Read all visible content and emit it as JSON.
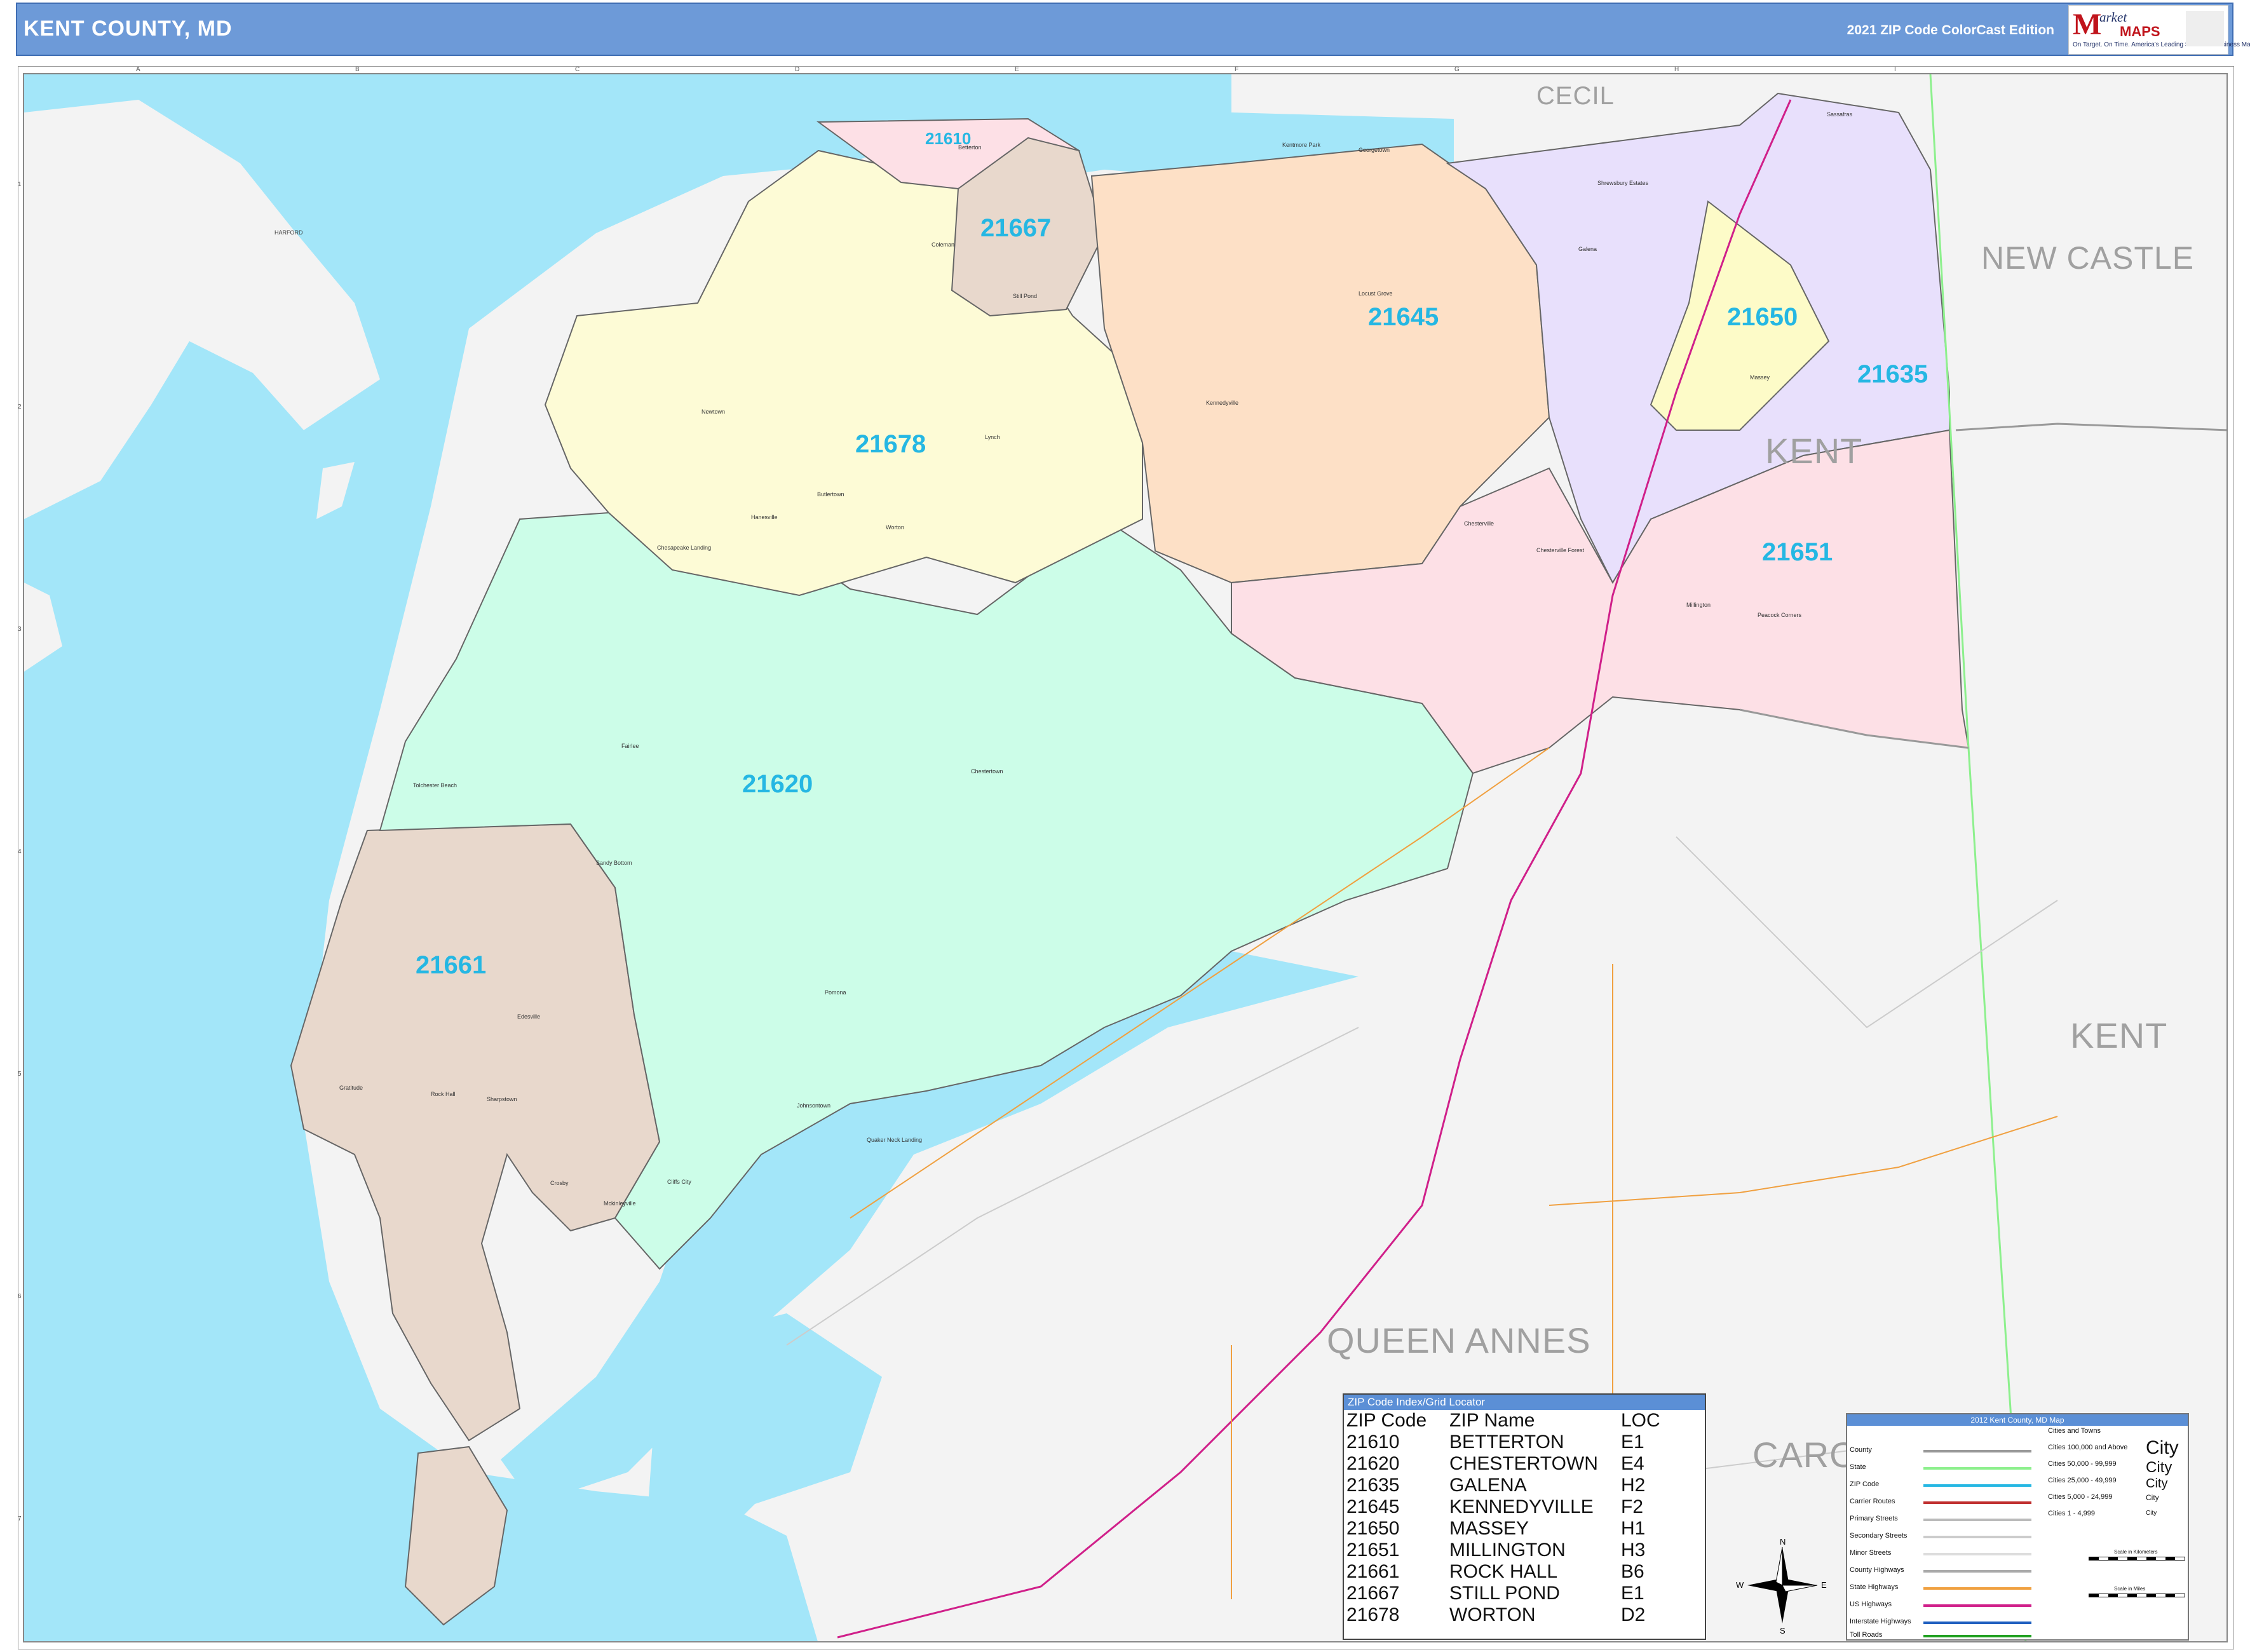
{
  "header": {
    "title": "KENT COUNTY, MD",
    "edition": "2021 ZIP Code ColorCast Edition",
    "logo": {
      "mark": "M",
      "market": "arket",
      "maps": "MAPS",
      "tagline": "On Target. On Time. America's Leading Source of Business Maps"
    }
  },
  "grid": {
    "columns": [
      "A",
      "B",
      "C",
      "D",
      "E",
      "F",
      "G",
      "H",
      "I"
    ],
    "rows": [
      "1",
      "2",
      "3",
      "4",
      "5",
      "6",
      "7"
    ]
  },
  "regions": [
    "CECIL",
    "NEW CASTLE",
    "KENT",
    "KENT",
    "QUEEN ANNES",
    "CARO"
  ],
  "zips": [
    "21610",
    "21667",
    "21645",
    "21650",
    "21635",
    "21678",
    "21651",
    "21620",
    "21661"
  ],
  "places": [
    "Betterton",
    "Still Pond",
    "Coleman",
    "Kentmore Park",
    "Georgetown",
    "Sassafras",
    "Galena",
    "Shrewsbury Estates",
    "Locust Grove",
    "Kennedyville",
    "Massey",
    "Newtown",
    "Lynch",
    "Butlertown",
    "Worton",
    "Chestertown",
    "Chesterville",
    "Millington",
    "Chesterville Forest",
    "Peacock Corners",
    "Hanesville",
    "Chesapeake Landing",
    "Fairlee",
    "Tolchester Beach",
    "Sandy Bottom",
    "Pomona",
    "Edesville",
    "Rock Hall",
    "Sharpstown",
    "Gratitude",
    "Crosby",
    "Johnsontown",
    "Quaker Neck Landing",
    "Cliffs City",
    "Mckinleyville",
    "HARFORD"
  ],
  "zip_index": {
    "title": "ZIP Code Index/Grid Locator",
    "headers": [
      "ZIP Code",
      "ZIP Name",
      "LOC"
    ],
    "rows": [
      [
        "21610",
        "BETTERTON",
        "E1"
      ],
      [
        "21620",
        "CHESTERTOWN",
        "E4"
      ],
      [
        "21635",
        "GALENA",
        "H2"
      ],
      [
        "21645",
        "KENNEDYVILLE",
        "F2"
      ],
      [
        "21650",
        "MASSEY",
        "H1"
      ],
      [
        "21651",
        "MILLINGTON",
        "H3"
      ],
      [
        "21661",
        "ROCK HALL",
        "B6"
      ],
      [
        "21667",
        "STILL POND",
        "E1"
      ],
      [
        "21678",
        "WORTON",
        "D2"
      ]
    ]
  },
  "legend": {
    "title": "2012 Kent County, MD Map",
    "items": [
      {
        "label": "County",
        "color": "#999999"
      },
      {
        "label": "State",
        "color": "#8df08d"
      },
      {
        "label": "ZIP Code",
        "color": "#25b7e3"
      },
      {
        "label": "Carrier Routes",
        "color": "#c03030"
      },
      {
        "label": "Primary Streets",
        "color": "#bbbbbb"
      },
      {
        "label": "Secondary Streets",
        "color": "#cccccc"
      },
      {
        "label": "Minor Streets",
        "color": "#dddddd"
      },
      {
        "label": "County Highways",
        "color": "#aaaaaa"
      },
      {
        "label": "State Highways",
        "color": "#f0a040"
      },
      {
        "label": "US Highways",
        "color": "#d0208a"
      },
      {
        "label": "Interstate Highways",
        "color": "#2060c0"
      },
      {
        "label": "Toll Roads",
        "color": "#20a020"
      }
    ],
    "cities_title": "Cities and Towns",
    "cities": [
      "Cities 100,000 and Above",
      "Cities 50,000 - 99,999",
      "Cities 25,000 - 49,999",
      "Cities 5,000 - 24,999",
      "Cities 1 - 4,999"
    ],
    "city_sample": "City",
    "scale_km": "Scale in Kilometers",
    "scale_mi": "Scale in Miles"
  },
  "compass": {
    "n": "N",
    "s": "S",
    "e": "E",
    "w": "W"
  },
  "colors": {
    "water": "#a3e6f9",
    "land": "#f3f3f3",
    "zip_21610": "#fde0e6",
    "zip_21667": "#e8d8cc",
    "zip_21678": "#fdfbd6",
    "zip_21645": "#fde0c6",
    "zip_21635": "#e8e0fc",
    "zip_21650": "#fdfbc8",
    "zip_21651": "#fde0e6",
    "zip_21620": "#ccfde8",
    "zip_21661": "#e8d8cc"
  }
}
